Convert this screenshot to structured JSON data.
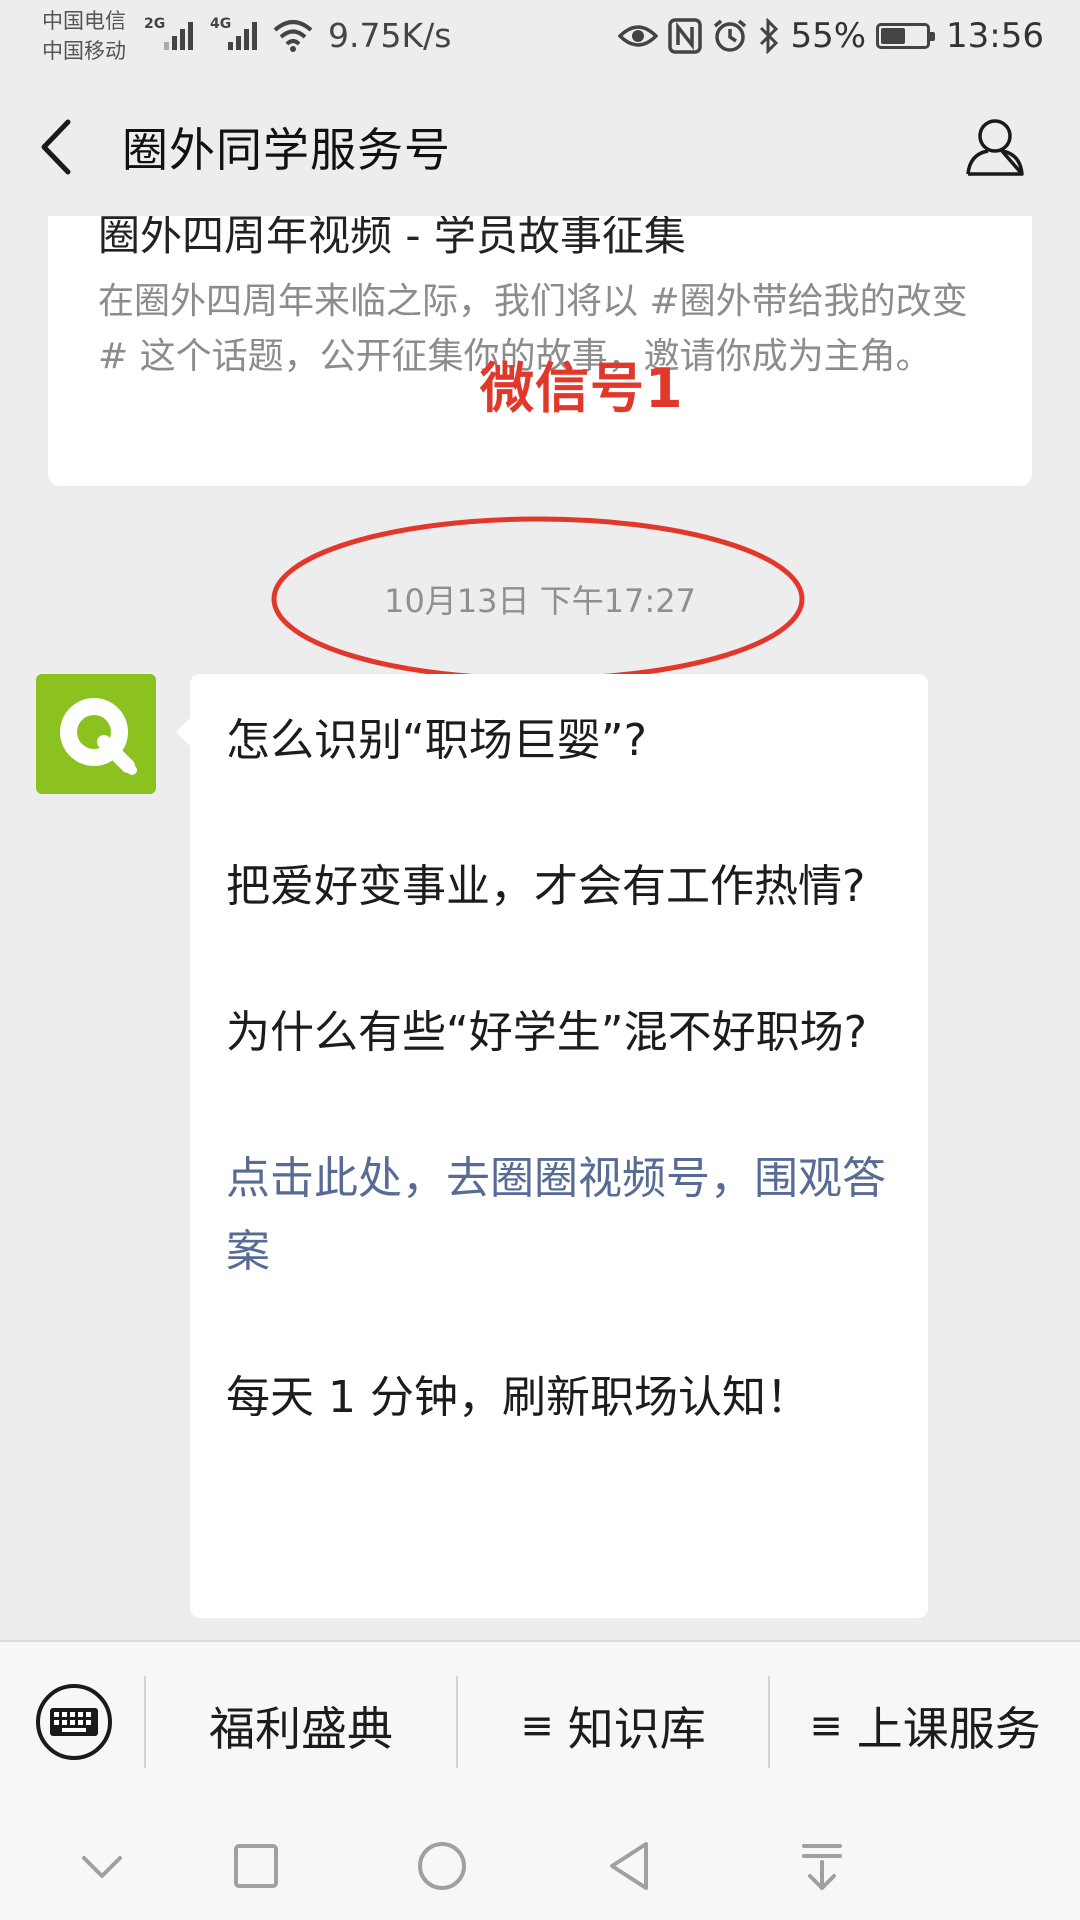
{
  "status_bar": {
    "carrier_1": "中国电信",
    "carrier_2": "中国移动",
    "network_1": "2G",
    "network_2": "4G",
    "net_speed": "9.75K/s",
    "battery_percent": "55%",
    "battery_level": 0.55,
    "time": "13:56",
    "icons": [
      "eye-icon",
      "nfc-icon",
      "alarm-icon",
      "bluetooth-icon",
      "battery-icon"
    ]
  },
  "header": {
    "title": "圈外同学服务号",
    "icons": [
      "back-icon",
      "profile-icon"
    ]
  },
  "chat": {
    "article": {
      "title": "圈外四周年视频 - 学员故事征集",
      "description": "在圈外四周年来临之际，我们将以 #圈外带给我的改变# 这个话题，公开征集你的故事，邀请你成为主角。"
    },
    "annotation": {
      "label": "微信号1",
      "color": "#e2382b"
    },
    "timestamp": "10月13日 下午17:27",
    "message": {
      "line_1": "怎么识别“职场巨婴”?",
      "line_2": "把爱好变事业，才会有工作热情?",
      "line_3": "为什么有些“好学生”混不好职场?",
      "link": "点击此处，去圈圈视频号，围观答案",
      "line_4": "每天 1 分钟，刷新职场认知！"
    },
    "avatar_color": "#8cc21f",
    "link_color": "#576b95"
  },
  "bottom_menu": {
    "items": [
      {
        "label": "福利盛典",
        "glyph": ""
      },
      {
        "label": "知识库",
        "glyph": "≡"
      },
      {
        "label": "上课服务",
        "glyph": "≡"
      }
    ],
    "icons": [
      "keyboard-icon"
    ]
  },
  "system_nav": {
    "icons": [
      "collapse-icon",
      "recents-icon",
      "home-icon",
      "back-triangle-icon",
      "notification-pull-icon"
    ]
  }
}
